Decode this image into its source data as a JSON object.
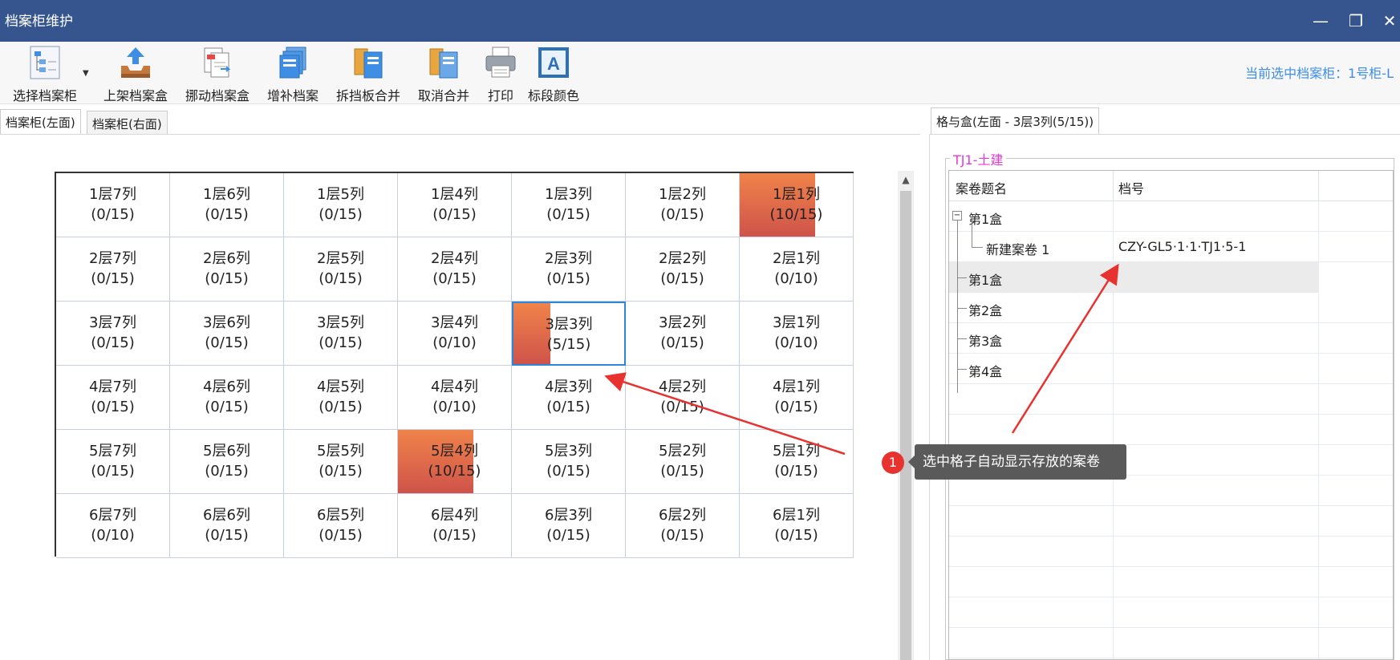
{
  "window": {
    "title": "档案柜维护",
    "minimize": "—",
    "restore": "❐",
    "close": "✕"
  },
  "toolbar": {
    "items": [
      {
        "label": "选择档案柜",
        "icon": "tree-select-icon"
      },
      {
        "label": "上架档案盒",
        "icon": "tray-upload-icon"
      },
      {
        "label": "挪动档案盒",
        "icon": "document-move-icon"
      },
      {
        "label": "增补档案",
        "icon": "stacked-files-icon"
      },
      {
        "label": "拆挡板合并",
        "icon": "split-files-icon"
      },
      {
        "label": "取消合并",
        "icon": "unmerge-files-icon"
      },
      {
        "label": "打印",
        "icon": "printer-icon"
      },
      {
        "label": "标段颜色",
        "icon": "color-letter-icon"
      }
    ],
    "current_cabinet": "当前选中档案柜：1号柜-L"
  },
  "left_tabs": [
    "档案柜(左面)",
    "档案柜(右面)"
  ],
  "grid": {
    "rows": [
      [
        {
          "label": "1层7列",
          "count": "(0/15)",
          "fill": 0
        },
        {
          "label": "1层6列",
          "count": "(0/15)",
          "fill": 0
        },
        {
          "label": "1层5列",
          "count": "(0/15)",
          "fill": 0
        },
        {
          "label": "1层4列",
          "count": "(0/15)",
          "fill": 0
        },
        {
          "label": "1层3列",
          "count": "(0/15)",
          "fill": 0
        },
        {
          "label": "1层2列",
          "count": "(0/15)",
          "fill": 0
        },
        {
          "label": "1层1列",
          "count": "(10/15)",
          "fill": 0.667
        }
      ],
      [
        {
          "label": "2层7列",
          "count": "(0/15)",
          "fill": 0
        },
        {
          "label": "2层6列",
          "count": "(0/15)",
          "fill": 0
        },
        {
          "label": "2层5列",
          "count": "(0/15)",
          "fill": 0
        },
        {
          "label": "2层4列",
          "count": "(0/15)",
          "fill": 0
        },
        {
          "label": "2层3列",
          "count": "(0/15)",
          "fill": 0
        },
        {
          "label": "2层2列",
          "count": "(0/15)",
          "fill": 0
        },
        {
          "label": "2层1列",
          "count": "(0/10)",
          "fill": 0
        }
      ],
      [
        {
          "label": "3层7列",
          "count": "(0/15)",
          "fill": 0
        },
        {
          "label": "3层6列",
          "count": "(0/15)",
          "fill": 0
        },
        {
          "label": "3层5列",
          "count": "(0/15)",
          "fill": 0
        },
        {
          "label": "3层4列",
          "count": "(0/10)",
          "fill": 0
        },
        {
          "label": "3层3列",
          "count": "(5/15)",
          "fill": 0.333,
          "selected": true
        },
        {
          "label": "3层2列",
          "count": "(0/15)",
          "fill": 0
        },
        {
          "label": "3层1列",
          "count": "(0/10)",
          "fill": 0
        }
      ],
      [
        {
          "label": "4层7列",
          "count": "(0/15)",
          "fill": 0
        },
        {
          "label": "4层6列",
          "count": "(0/15)",
          "fill": 0
        },
        {
          "label": "4层5列",
          "count": "(0/15)",
          "fill": 0
        },
        {
          "label": "4层4列",
          "count": "(0/10)",
          "fill": 0
        },
        {
          "label": "4层3列",
          "count": "(0/15)",
          "fill": 0
        },
        {
          "label": "4层2列",
          "count": "(0/15)",
          "fill": 0
        },
        {
          "label": "4层1列",
          "count": "(0/15)",
          "fill": 0
        }
      ],
      [
        {
          "label": "5层7列",
          "count": "(0/15)",
          "fill": 0
        },
        {
          "label": "5层6列",
          "count": "(0/15)",
          "fill": 0
        },
        {
          "label": "5层5列",
          "count": "(0/15)",
          "fill": 0
        },
        {
          "label": "5层4列",
          "count": "(10/15)",
          "fill": 0.667
        },
        {
          "label": "5层3列",
          "count": "(0/15)",
          "fill": 0
        },
        {
          "label": "5层2列",
          "count": "(0/15)",
          "fill": 0
        },
        {
          "label": "5层1列",
          "count": "(0/15)",
          "fill": 0
        }
      ],
      [
        {
          "label": "6层7列",
          "count": "(0/10)",
          "fill": 0
        },
        {
          "label": "6层6列",
          "count": "(0/15)",
          "fill": 0
        },
        {
          "label": "6层5列",
          "count": "(0/15)",
          "fill": 0
        },
        {
          "label": "6层4列",
          "count": "(0/15)",
          "fill": 0
        },
        {
          "label": "6层3列",
          "count": "(0/15)",
          "fill": 0
        },
        {
          "label": "6层2列",
          "count": "(0/15)",
          "fill": 0
        },
        {
          "label": "6层1列",
          "count": "(0/15)",
          "fill": 0
        }
      ]
    ]
  },
  "annotation": {
    "badge": "1",
    "text": "选中格子自动显示存放的案卷"
  },
  "right": {
    "tab": "格与盒(左面 - 3层3列(5/15))",
    "group_title": "TJ1-土建",
    "headers": [
      "案卷题名",
      "档号"
    ],
    "rows": [
      {
        "name": "第1盒",
        "code": ""
      },
      {
        "name": "新建案卷 1",
        "code": "CZY-GL5·1·1·TJ1·5-1"
      },
      {
        "name": "第1盒",
        "code": ""
      },
      {
        "name": "第2盒",
        "code": ""
      },
      {
        "name": "第3盒",
        "code": ""
      },
      {
        "name": "第4盒",
        "code": ""
      }
    ],
    "expander": "−"
  },
  "colors": {
    "titlebar": "#36558f",
    "fill": "#e06a4a",
    "selected_border": "#2d86d9",
    "accent_text": "#3e8ee6",
    "group_title": "#e23bd6",
    "annotation_badge": "#e8322f"
  }
}
